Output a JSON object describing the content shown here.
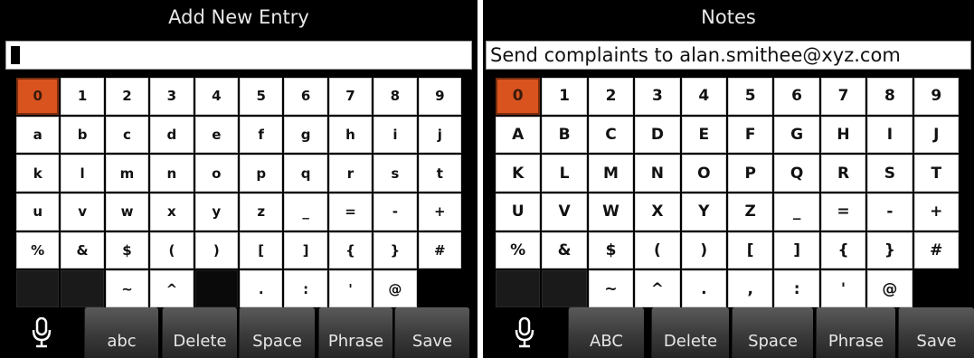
{
  "left_screen": {
    "title": "Add New Entry",
    "entry_value": "",
    "keyboard_rows": [
      [
        "0",
        "1",
        "2",
        "3",
        "4",
        "5",
        "6",
        "7",
        "8",
        "9"
      ],
      [
        "a",
        "b",
        "c",
        "d",
        "e",
        "f",
        "g",
        "h",
        "i",
        "j"
      ],
      [
        "k",
        "l",
        "m",
        "n",
        "o",
        "p",
        "q",
        "r",
        "s",
        "t"
      ],
      [
        "u",
        "v",
        "w",
        "x",
        "y",
        "z",
        "_",
        "=",
        "-",
        "+"
      ],
      [
        "%",
        "&",
        "$",
        "(",
        ")",
        "[",
        "]",
        "{",
        "}",
        "#"
      ],
      [
        "",
        "",
        "~",
        "^",
        "",
        ".",
        ":",
        "'",
        "@",
        ""
      ]
    ],
    "selected_key": "0",
    "softkeys": [
      "abc",
      "Delete",
      "Space",
      "Phrase",
      "Save"
    ]
  },
  "right_screen": {
    "title": "Notes",
    "entry_value": "Send complaints to alan.smithee@xyz.com",
    "keyboard_rows": [
      [
        "0",
        "1",
        "2",
        "3",
        "4",
        "5",
        "6",
        "7",
        "8",
        "9"
      ],
      [
        "A",
        "B",
        "C",
        "D",
        "E",
        "F",
        "G",
        "H",
        "I",
        "J"
      ],
      [
        "K",
        "L",
        "M",
        "N",
        "O",
        "P",
        "Q",
        "R",
        "S",
        "T"
      ],
      [
        "U",
        "V",
        "W",
        "X",
        "Y",
        "Z",
        "_",
        "=",
        "-",
        "+"
      ],
      [
        "%",
        "&",
        "$",
        "(",
        ")",
        "[",
        "]",
        "{",
        "}",
        "#"
      ],
      [
        "",
        "",
        "~",
        "^",
        ".",
        ",",
        ":",
        "'",
        "@",
        ""
      ]
    ],
    "selected_key": "0",
    "softkeys": [
      "ABC",
      "Delete",
      "Space",
      "Phrase",
      "Save"
    ]
  },
  "icons": {
    "mic": "microphone-icon"
  },
  "colors": {
    "screen_background": "#000000",
    "key_background": "#ffffff",
    "selected_key": "#d9531e",
    "softkey_background": "#3a3a3a"
  }
}
